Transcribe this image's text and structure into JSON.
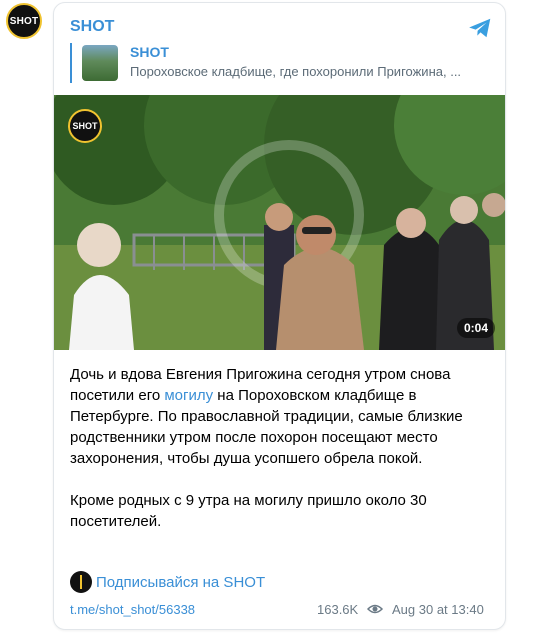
{
  "channel": {
    "avatar_text": "SHOT",
    "name": "SHOT"
  },
  "reply": {
    "title": "SHOT",
    "text": "Пороховское кладбище, где похоронили Пригожина, ..."
  },
  "video": {
    "watermark": "SHOT",
    "duration": "0:04"
  },
  "message": {
    "para1_before": "Дочь и вдова Евгения Пригожина сегодня утром снова посетили его ",
    "para1_link": "могилу",
    "para1_after": " на Пороховском кладбище в Петербурге. По православной традиции, самые близкие родственники утром после похорон посещают место захоронения, чтобы душа усопшего обрела покой.",
    "para2": "Кроме родных с 9 утра на могилу пришло около 30 посетителей."
  },
  "subscribe": {
    "label": "Подписывайся на SHOT"
  },
  "footer": {
    "link": "t.me/shot_shot/56338",
    "views": "163.6K",
    "date": "Aug 30 at 13:40"
  },
  "colors": {
    "accent": "#3a8fd6",
    "brand_yellow": "#f0c330"
  }
}
